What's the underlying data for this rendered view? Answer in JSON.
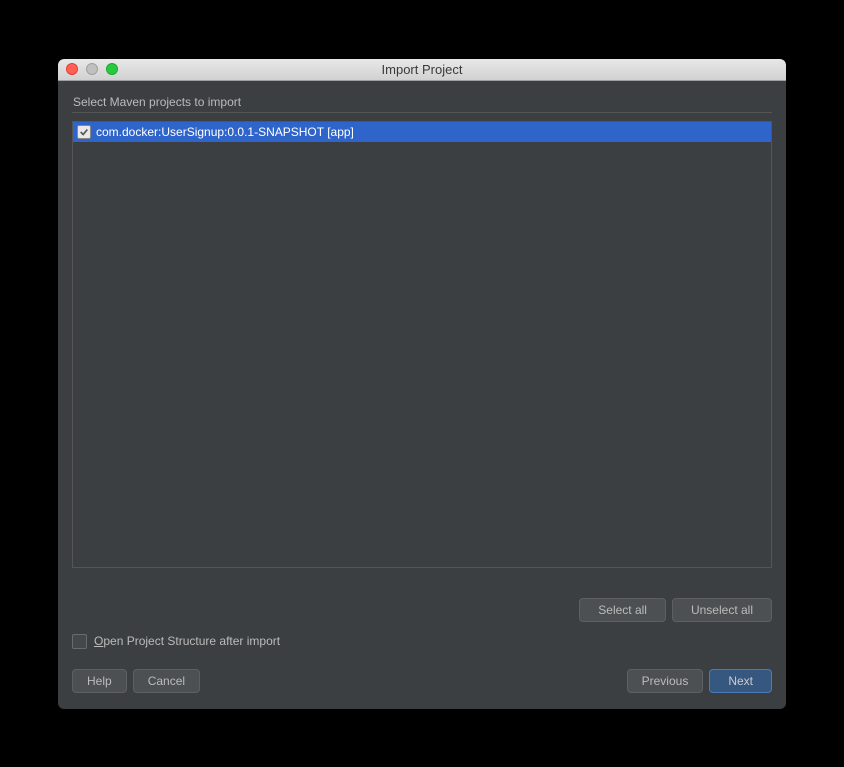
{
  "window": {
    "title": "Import Project"
  },
  "header": {
    "subtitle": "Select Maven projects to import"
  },
  "list": {
    "items": [
      {
        "label": "com.docker:UserSignup:0.0.1-SNAPSHOT [app]",
        "checked": true,
        "selected": true
      }
    ]
  },
  "selectButtons": {
    "selectAll": "Select all",
    "unselectAll": "Unselect all"
  },
  "option": {
    "label_prefix": "O",
    "label_rest": "pen Project Structure after import",
    "checked": false
  },
  "buttons": {
    "help": "Help",
    "cancel": "Cancel",
    "previous": "Previous",
    "next": "Next"
  }
}
